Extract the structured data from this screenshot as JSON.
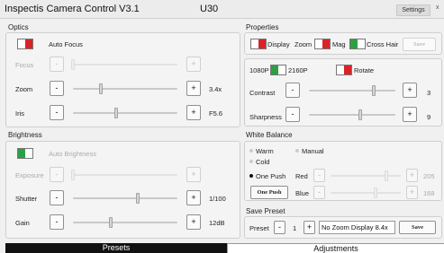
{
  "title": {
    "app": "Inspectis Camera Control V3.1",
    "model": "U30",
    "settings": "Settings",
    "close": "x"
  },
  "colors": {
    "on": "#2ea043",
    "off": "#d9232a"
  },
  "optics": {
    "title": "Optics",
    "autofocus": {
      "label": "Auto Focus",
      "state": "off"
    },
    "focus": {
      "label": "Focus",
      "minus": "-",
      "plus": "+",
      "value": "",
      "level": 0.0
    },
    "zoom": {
      "label": "Zoom",
      "minus": "-",
      "plus": "+",
      "value": "3.4x",
      "level": 0.25
    },
    "iris": {
      "label": "Iris",
      "minus": "-",
      "plus": "+",
      "value": "F5.6",
      "level": 0.4
    }
  },
  "brightness": {
    "title": "Brightness",
    "auto": {
      "label": "Auto Brightness",
      "state": "on"
    },
    "exposure": {
      "label": "Exposure",
      "minus": "-",
      "plus": "+",
      "value": ""
    },
    "shutter": {
      "label": "Shutter",
      "minus": "-",
      "plus": "+",
      "value": "1/100",
      "level": 0.6
    },
    "gain": {
      "label": "Gain",
      "minus": "-",
      "plus": "+",
      "value": "12dB",
      "level": 0.33
    }
  },
  "properties": {
    "title": "Properties",
    "display": {
      "label": "Display",
      "state": "off"
    },
    "zoom_label": "Zoom",
    "mag": {
      "label": "Mag",
      "state": "off"
    },
    "crosshair": {
      "label": "Cross Hair",
      "state": "on"
    },
    "save": "Save",
    "res_1080": "1080P",
    "res_2160": "2160P",
    "res_state": "on",
    "rotate": {
      "label": "Rotate",
      "state": "off"
    },
    "contrast": {
      "label": "Contrast",
      "minus": "-",
      "plus": "+",
      "value": "3",
      "level": 0.75
    },
    "sharpness": {
      "label": "Sharpness",
      "minus": "-",
      "plus": "+",
      "value": "9",
      "level": 0.6
    }
  },
  "white_balance": {
    "title": "White Balance",
    "warm": "Warm",
    "manual": "Manual",
    "cold": "Cold",
    "one_push": "One Push",
    "one_push_button": "One Push",
    "red": {
      "label": "Red",
      "minus": "-",
      "plus": "+",
      "value": "205"
    },
    "blue": {
      "label": "Blue",
      "minus": "-",
      "plus": "+",
      "value": "168"
    }
  },
  "save_preset": {
    "title": "Save Preset",
    "label": "Preset",
    "minus": "-",
    "number": "1",
    "plus": "+",
    "name": "No Zoom Display 8.4x",
    "save": "Save"
  },
  "tabs": {
    "presets": "Presets",
    "adjustments": "Adjustments"
  }
}
